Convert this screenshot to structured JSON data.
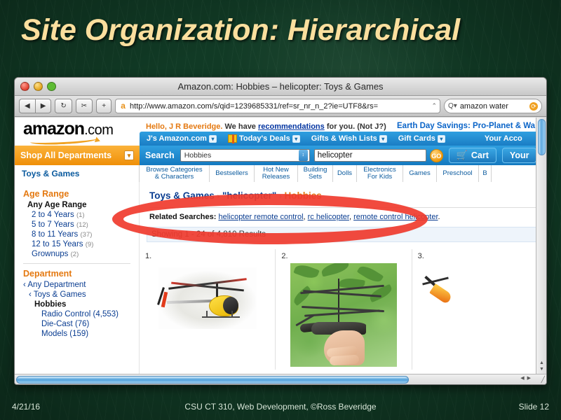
{
  "slide": {
    "title": "Site Organization: Hierarchical",
    "footer_date": "4/21/16",
    "footer_center": "CSU CT 310, Web Development, ©Ross Beveridge",
    "footer_slide": "Slide 12",
    "title_color": "#fbdf9e",
    "background_color": "#113a25"
  },
  "browser": {
    "window_title": "Amazon.com: Hobbies – helicopter: Toys & Games",
    "back_icon": "◀",
    "forward_icon": "▶",
    "reload_icon": "↻",
    "snip_icon": "✂",
    "add_icon": "+",
    "favicon_letter": "a",
    "url": "http://www.amazon.com/s/qid=1239685331/ref=sr_nr_n_2?ie=UTF8&rs=",
    "url_overflow": "⌃",
    "search_icon": "Q▾",
    "search_value": "amazon water",
    "search_clear_icon": "⟳"
  },
  "amazon": {
    "logo": "amazon",
    "logo_suffix": ".com",
    "greeting_prefix": "Hello, J R Beveridge.",
    "greeting_mid": "We have",
    "greeting_link": "recommendations",
    "greeting_suffix": "for you. (Not J?)",
    "promo": "Earth Day Savings: Pro-Planet & Wa",
    "nav": [
      {
        "label": "J's Amazon.com",
        "caret": "▾",
        "icon": ""
      },
      {
        "label": "Today's Deals",
        "caret": "▾",
        "icon": "gift-box"
      },
      {
        "label": "Gifts & Wish Lists",
        "caret": "▾",
        "icon": ""
      },
      {
        "label": "Gift Cards",
        "caret": "▾",
        "icon": ""
      },
      {
        "label": "Your Acco",
        "caret": "",
        "icon": ""
      }
    ],
    "shop_all": "Shop All Departments",
    "shop_all_caret": "▾",
    "search_label": "Search",
    "search_category": "Hobbies",
    "search_category_arrow": "↕",
    "search_query": "helicopter",
    "go_label": "GO",
    "cart_label": "Cart",
    "cart_icon": "🛒",
    "your_label": "Your",
    "department_tab": "Toys & Games",
    "subtabs": [
      "Browse Categories & Characters",
      "Bestsellers",
      "Hot New Releases",
      "Building Sets",
      "Dolls",
      "Electronics For Kids",
      "Games",
      "Preschool",
      "B"
    ]
  },
  "sidebar": {
    "age_range_heading": "Age Range",
    "age_range_selected": "Any Age Range",
    "age_ranges": [
      {
        "label": "2 to 4 Years",
        "count": "(1)"
      },
      {
        "label": "5 to 7 Years",
        "count": "(12)"
      },
      {
        "label": "8 to 11 Years",
        "count": "(37)"
      },
      {
        "label": "12 to 15 Years",
        "count": "(9)"
      },
      {
        "label": "Grownups",
        "count": "(2)"
      }
    ],
    "department_heading": "Department",
    "dept_any": "‹ Any Department",
    "dept_toys": "‹ Toys & Games",
    "dept_hobbies": "Hobbies",
    "dept_children": [
      {
        "label": "Radio Control",
        "count": "(4,553)"
      },
      {
        "label": "Die-Cast",
        "count": "(76)"
      },
      {
        "label": "Models",
        "count": "(159)"
      }
    ]
  },
  "results": {
    "breadcrumb_1": "Toys & Games",
    "breadcrumb_sep": "›",
    "breadcrumb_2": "\"helicopter\"",
    "breadcrumb_3": "Hobbies",
    "related_label": "Related Searches:",
    "related_links": [
      "helicopter remote control",
      "rc helicopter",
      "remote control helicopter"
    ],
    "showing": "Showing 1 - 24 of 4,810 Results",
    "items": [
      {
        "number": "1."
      },
      {
        "number": "2."
      },
      {
        "number": "3."
      }
    ]
  },
  "annotation": {
    "shape": "ellipse",
    "color": "#f03b2e",
    "target": "breadcrumb"
  }
}
